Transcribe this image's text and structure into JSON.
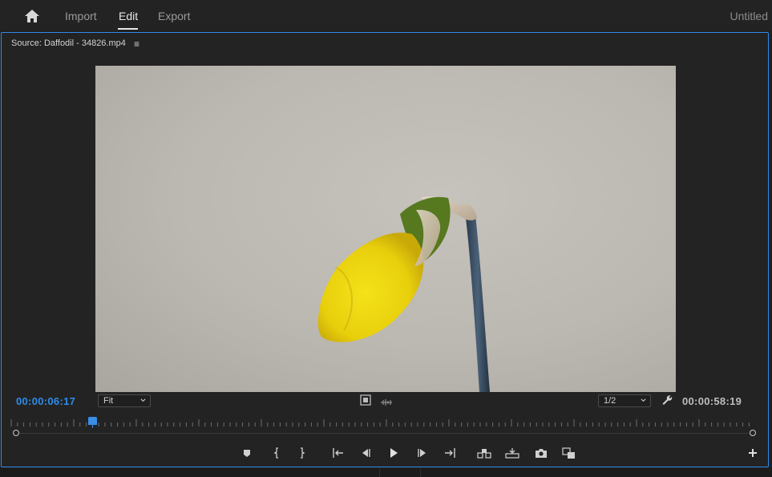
{
  "header": {
    "home_icon": "home-icon",
    "tabs": [
      {
        "label": "Import"
      },
      {
        "label": "Edit",
        "active": true
      },
      {
        "label": "Export"
      }
    ],
    "project_title": "Untitled"
  },
  "source_monitor": {
    "title": "Source: Daffodil - 34826.mp4",
    "menu_glyph": "≡",
    "current_timecode": "00:00:06:17",
    "duration_timecode": "00:00:58:19",
    "zoom": {
      "value": "Fit"
    },
    "resolution": {
      "value": "1/2"
    },
    "playhead_progress": 0.11,
    "accent_color": "#2d8ceb"
  },
  "transport": {
    "buttons": [
      "add-marker-icon",
      "mark-in-icon",
      "mark-out-icon",
      "go-to-in-icon",
      "step-back-icon",
      "play-icon",
      "step-forward-icon",
      "go-to-out-icon",
      "insert-icon",
      "overwrite-icon",
      "export-frame-icon",
      "compare-icon",
      "add-button-icon"
    ]
  }
}
